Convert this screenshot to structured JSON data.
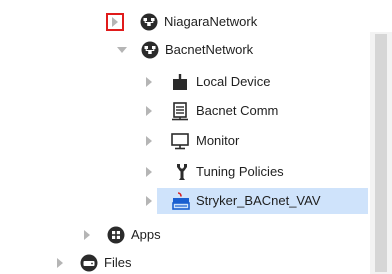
{
  "tree": {
    "nodes": [
      {
        "label": "NiagaraNetwork",
        "icon": "network-globe-icon",
        "state": "collapsed"
      },
      {
        "label": "BacnetNetwork",
        "icon": "network-globe-icon",
        "state": "expanded"
      },
      {
        "label": "Local Device",
        "icon": "local-device-icon",
        "state": "collapsed"
      },
      {
        "label": "Bacnet Comm",
        "icon": "server-icon",
        "state": "collapsed"
      },
      {
        "label": "Monitor",
        "icon": "monitor-icon",
        "state": "collapsed"
      },
      {
        "label": "Tuning Policies",
        "icon": "wrench-icon",
        "state": "collapsed"
      },
      {
        "label": "Stryker_BACnet_VAV",
        "icon": "bacnet-device-icon",
        "state": "collapsed",
        "selected": true
      },
      {
        "label": "Apps",
        "icon": "apps-icon",
        "state": "collapsed"
      },
      {
        "label": "Files",
        "icon": "files-drive-icon",
        "state": "collapsed"
      }
    ]
  },
  "colors": {
    "selection": "#cfe3fb",
    "highlight_box": "#e01b1b",
    "arrow": "#b5b5b5",
    "icon_dark": "#2b2b2b",
    "device_blue": "#1a5fd0",
    "device_red": "#d81f1f"
  }
}
